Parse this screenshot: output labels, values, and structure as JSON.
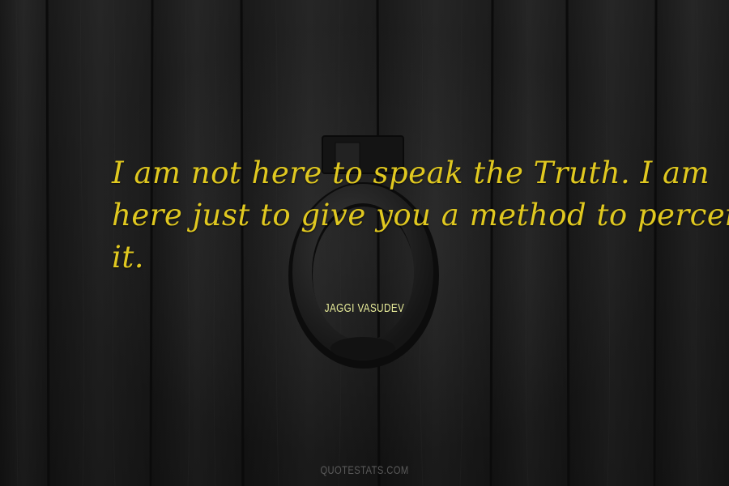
{
  "quote": {
    "lines": [
      "I am not here to speak the Truth. I am",
      "here just to give you a method to perceive",
      "it."
    ],
    "color": "#e0c820"
  },
  "author": {
    "name": "JAGGI VASUDEV",
    "color": "#e8ec9a"
  },
  "watermark": {
    "text": "QUOTESTATS.COM"
  },
  "background": {
    "subject": "dark-wood-door-with-ring-knocker",
    "colors": {
      "wood_dark": "#1c1c1c",
      "wood_light": "#2e2e2e",
      "metal": "#2a2a2a"
    }
  }
}
